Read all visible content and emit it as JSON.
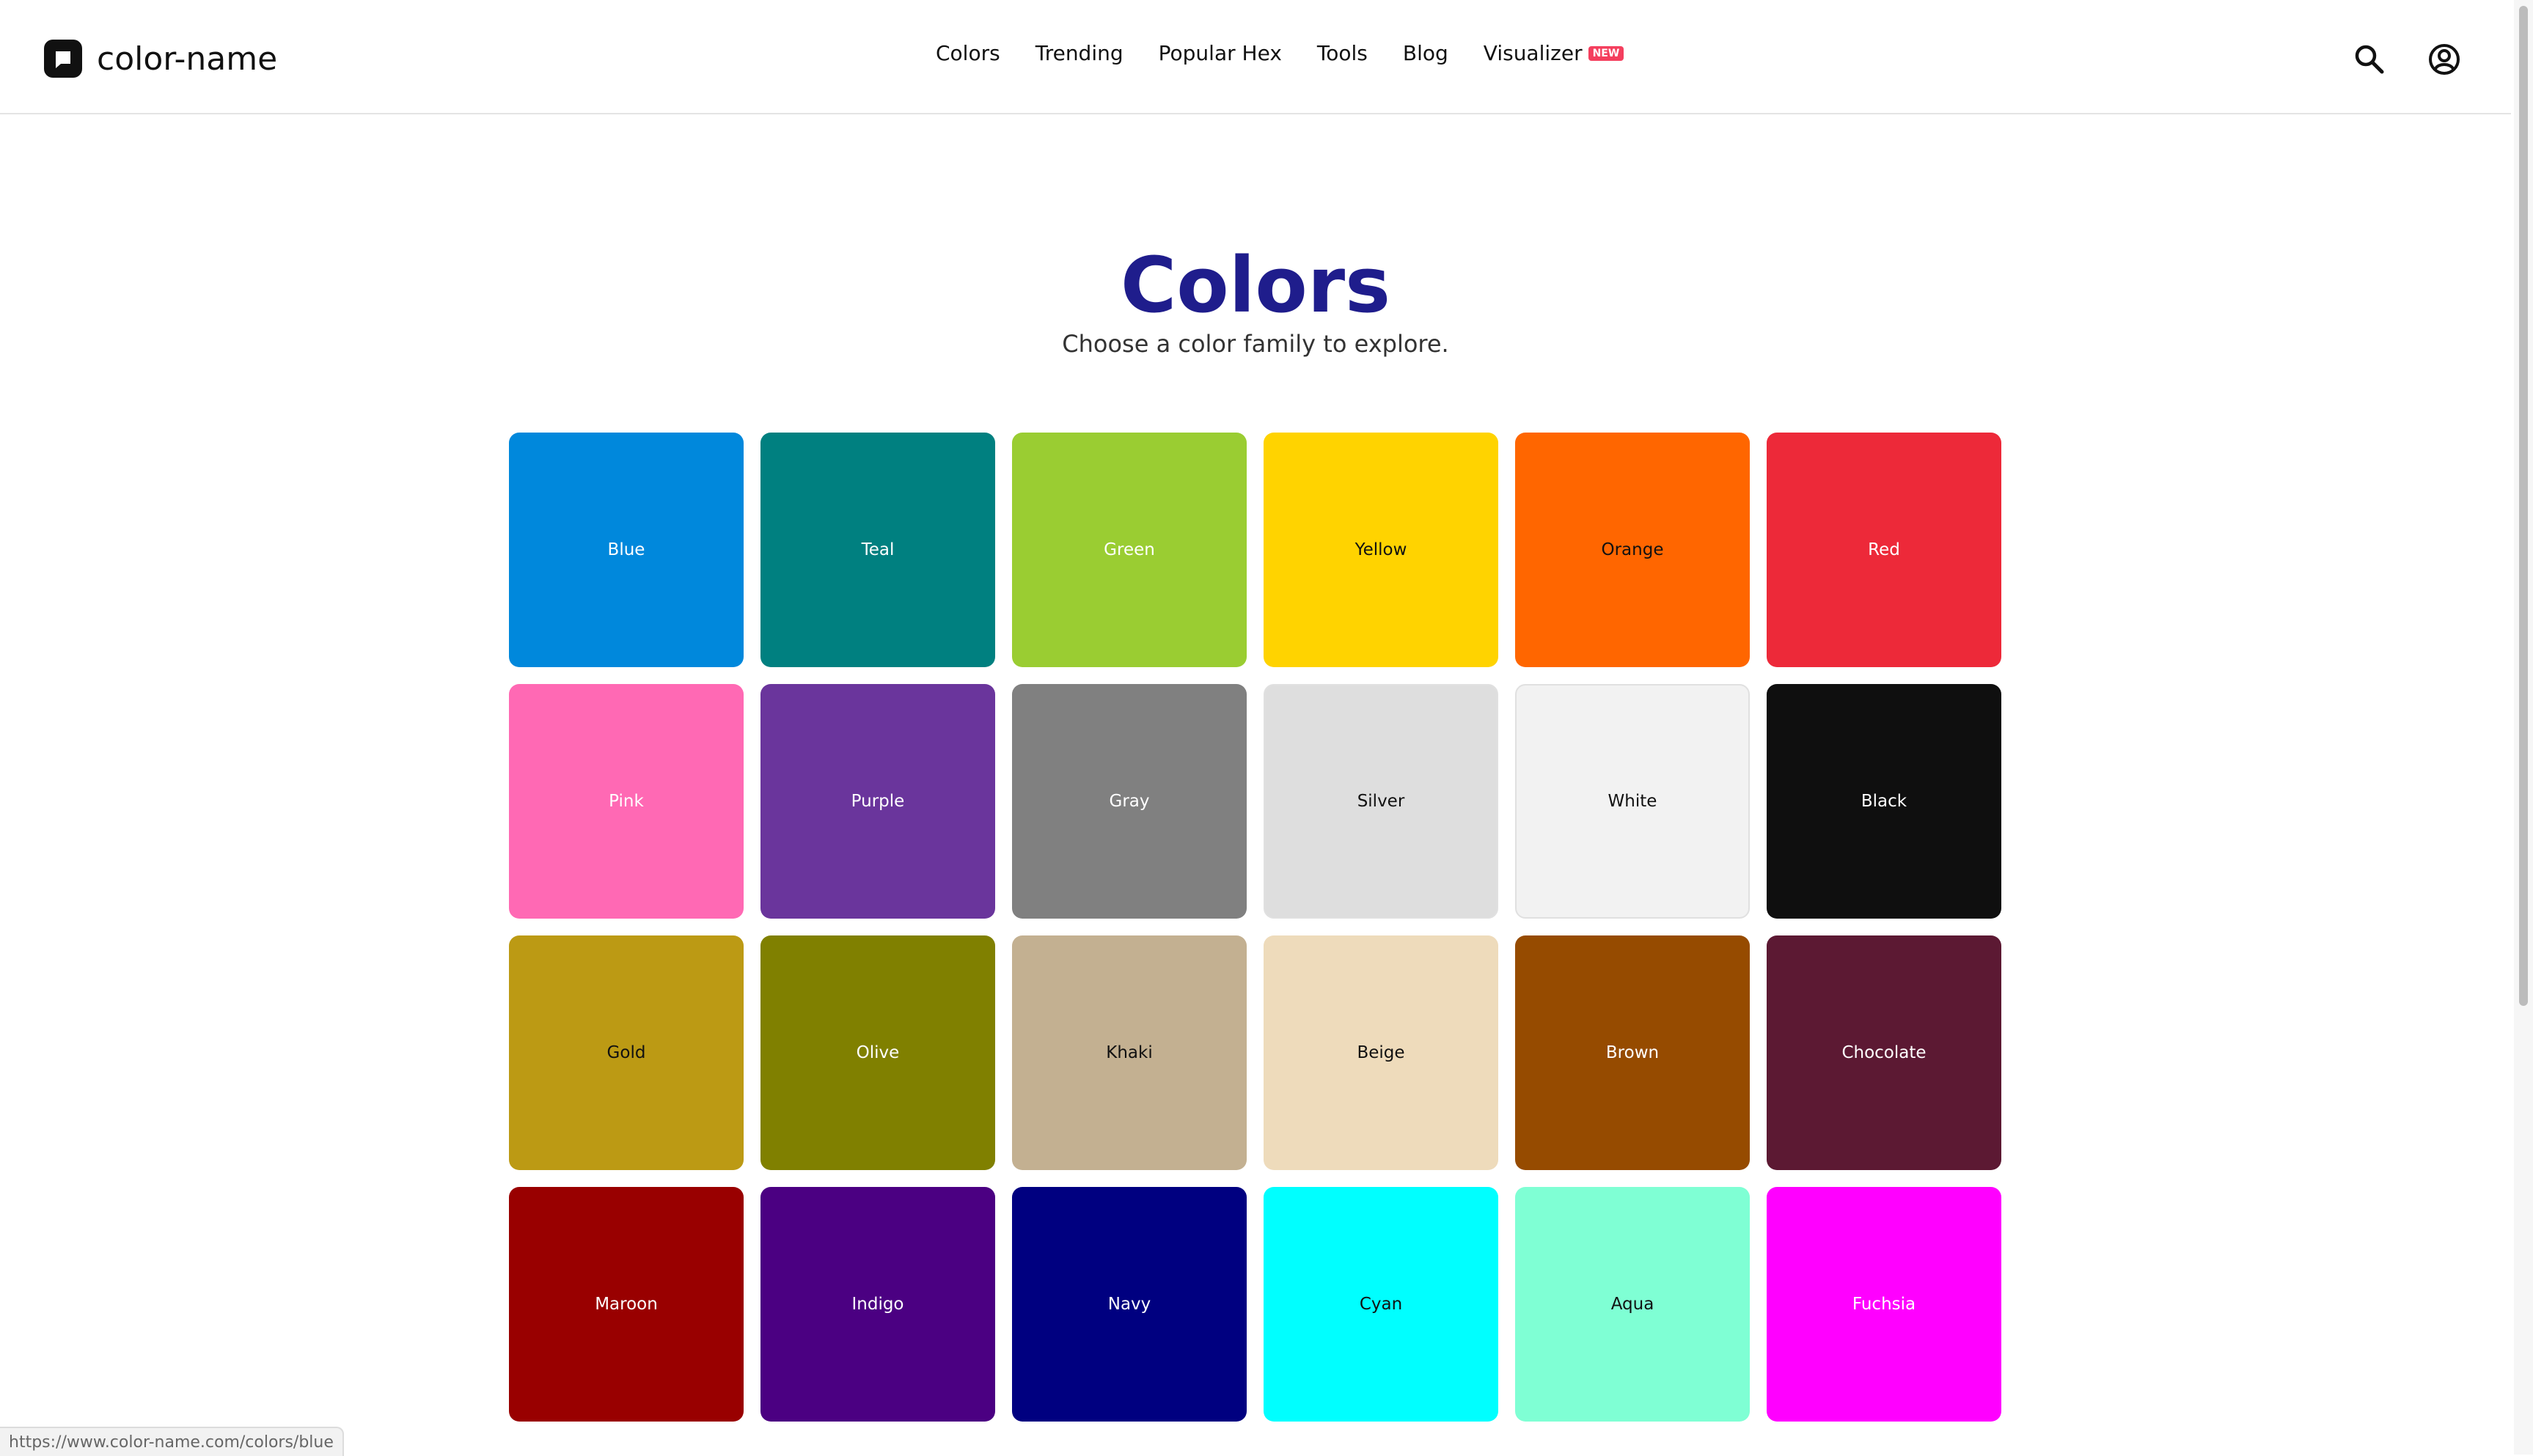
{
  "header": {
    "logo_text": "color-name",
    "nav": [
      {
        "label": "Colors"
      },
      {
        "label": "Trending"
      },
      {
        "label": "Popular Hex"
      },
      {
        "label": "Tools"
      },
      {
        "label": "Blog"
      },
      {
        "label": "Visualizer",
        "badge": "NEW"
      }
    ],
    "icons": [
      "search-icon",
      "account-icon"
    ]
  },
  "main": {
    "title": "Colors",
    "subtitle": "Choose a color family to explore."
  },
  "colors": [
    {
      "label": "Blue",
      "bg": "#0088dc",
      "fg": "#ffffff"
    },
    {
      "label": "Teal",
      "bg": "#008080",
      "fg": "#ffffff"
    },
    {
      "label": "Green",
      "bg": "#9acd32",
      "fg": "#ffffff"
    },
    {
      "label": "Yellow",
      "bg": "#ffd300",
      "fg": "#111111"
    },
    {
      "label": "Orange",
      "bg": "#ff6600",
      "fg": "#111111"
    },
    {
      "label": "Red",
      "bg": "#ed2939",
      "fg": "#ffffff"
    },
    {
      "label": "Pink",
      "bg": "#ff69b4",
      "fg": "#ffffff"
    },
    {
      "label": "Purple",
      "bg": "#6a359c",
      "fg": "#ffffff"
    },
    {
      "label": "Gray",
      "bg": "#808080",
      "fg": "#ffffff"
    },
    {
      "label": "Silver",
      "bg": "#dedede",
      "fg": "#111111"
    },
    {
      "label": "White",
      "bg": "#f2f2f2",
      "fg": "#111111"
    },
    {
      "label": "Black",
      "bg": "#0f0f0f",
      "fg": "#ffffff"
    },
    {
      "label": "Gold",
      "bg": "#bc9a14",
      "fg": "#111111"
    },
    {
      "label": "Olive",
      "bg": "#808000",
      "fg": "#ffffff"
    },
    {
      "label": "Khaki",
      "bg": "#c3b091",
      "fg": "#111111"
    },
    {
      "label": "Beige",
      "bg": "#eedbbb",
      "fg": "#111111"
    },
    {
      "label": "Brown",
      "bg": "#964b00",
      "fg": "#ffffff"
    },
    {
      "label": "Chocolate",
      "bg": "#5c1933",
      "fg": "#ffffff"
    },
    {
      "label": "Maroon",
      "bg": "#990000",
      "fg": "#ffffff"
    },
    {
      "label": "Indigo",
      "bg": "#4b0082",
      "fg": "#ffffff"
    },
    {
      "label": "Navy",
      "bg": "#000080",
      "fg": "#ffffff"
    },
    {
      "label": "Cyan",
      "bg": "#00ffff",
      "fg": "#111111"
    },
    {
      "label": "Aqua",
      "bg": "#7fffd4",
      "fg": "#111111"
    },
    {
      "label": "Fuchsia",
      "bg": "#ff00ff",
      "fg": "#ffffff"
    }
  ],
  "status_bar": {
    "url": "https://www.color-name.com/colors/blue"
  }
}
